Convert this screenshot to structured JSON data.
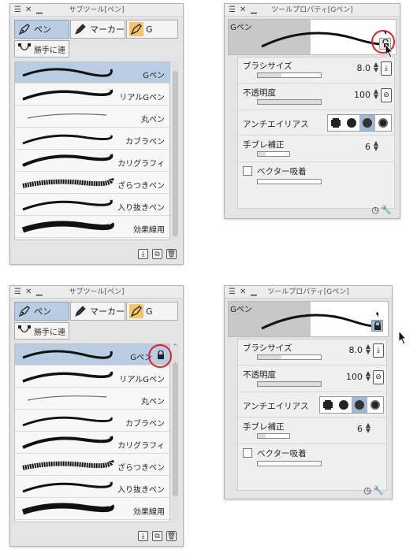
{
  "panels": {
    "subtool_title": "サブツール[ペン]",
    "toolprop_title": "ツールプロパティ[Gペン]"
  },
  "tabs": {
    "pen": "ペン",
    "marker": "マーカー",
    "g": "G",
    "custom": "勝手に連"
  },
  "brushes": [
    "Gペン",
    "リアルGペン",
    "丸ペン",
    "カブラペン",
    "カリグラフィ",
    "ざらつきペン",
    "入り抜きペン",
    "効果線用"
  ],
  "preview": {
    "name": "Gペン"
  },
  "properties": {
    "brush_size_label": "ブラシサイズ",
    "brush_size_value": "8.0",
    "opacity_label": "不透明度",
    "opacity_value": "100",
    "antialias_label": "アンチエイリアス",
    "stabilize_label": "手ブレ補正",
    "stabilize_value": "6",
    "vector_label": "ベクター吸着"
  },
  "colors": {
    "selected_row": "#b9cde2",
    "highlight_circle": "#e0202a",
    "orange_tab": "#f5c36a"
  }
}
